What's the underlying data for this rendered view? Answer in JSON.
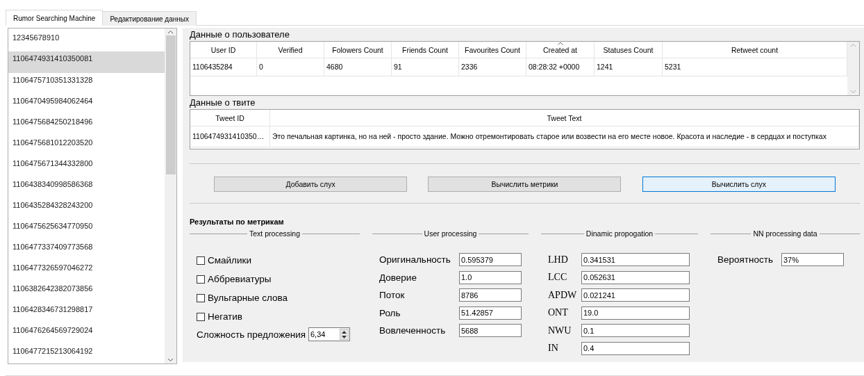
{
  "tabs": [
    {
      "label": "Rumor Searching Machine",
      "selected": true
    },
    {
      "label": "Редактирование данных",
      "selected": false
    }
  ],
  "tweet_list": {
    "items": [
      {
        "label": "12345678910",
        "selected": false
      },
      {
        "label": "1106474931410350081",
        "selected": true
      },
      {
        "label": "1106475710351331328",
        "selected": false
      },
      {
        "label": "1106470495984062464",
        "selected": false
      },
      {
        "label": "1106475684250218496",
        "selected": false
      },
      {
        "label": "1106475681012203520",
        "selected": false
      },
      {
        "label": "1106475671344332800",
        "selected": false
      },
      {
        "label": "1106438340998586368",
        "selected": false
      },
      {
        "label": "1106435284328243200",
        "selected": false
      },
      {
        "label": "1106475625634770950",
        "selected": false
      },
      {
        "label": "1106477337409773568",
        "selected": false
      },
      {
        "label": "1106477326597046272",
        "selected": false
      },
      {
        "label": "1106382642382073856",
        "selected": false
      },
      {
        "label": "1106428346731298817",
        "selected": false
      },
      {
        "label": "1106476264569729024",
        "selected": false
      },
      {
        "label": "1106477215213064192",
        "selected": false
      }
    ]
  },
  "user_section": {
    "title": "Данные о пользователе",
    "columns": [
      {
        "label": "User ID",
        "sorted": false
      },
      {
        "label": "Verified",
        "sorted": false
      },
      {
        "label": "Folowers Count",
        "sorted": false
      },
      {
        "label": "Friends Count",
        "sorted": false
      },
      {
        "label": "Favourites Count",
        "sorted": false
      },
      {
        "label": "Created at",
        "sorted": true
      },
      {
        "label": "Statuses Count",
        "sorted": false
      },
      {
        "label": "Retweet count",
        "sorted": false
      }
    ],
    "rows": [
      [
        "1106435284",
        "0",
        "4680",
        "91",
        "2336",
        "08:28:32 +0000",
        "1241",
        "5231"
      ]
    ]
  },
  "tweet_section": {
    "title": "Данные о твите",
    "columns": [
      {
        "label": "Tweet ID"
      },
      {
        "label": "Tweet Text"
      }
    ],
    "rows": [
      [
        "1106474931410350…",
        "Это печальная картинка, но на ней - просто здание. Можно отремонтировать старое или возвести на его месте новое. Красота и наследие - в сердцах и поступках"
      ]
    ]
  },
  "buttons": [
    {
      "label": "Добавить слух",
      "focused": false
    },
    {
      "label": "Вычислить метрики",
      "focused": false
    },
    {
      "label": "Вычислить слух",
      "focused": true
    }
  ],
  "results": {
    "title": "Результаты по метрикам",
    "groups": [
      {
        "title": "Text processing",
        "kind": "checks",
        "items": [
          {
            "label": "Смайлики",
            "checked": false
          },
          {
            "label": "Аббревиатуры",
            "checked": false
          },
          {
            "label": "Вульгарные слова",
            "checked": false
          },
          {
            "label": "Негатив",
            "checked": false
          }
        ],
        "spinner": {
          "label": "Сложность предложения",
          "value": "6,34"
        }
      },
      {
        "title": "User processing",
        "kind": "fields",
        "items": [
          {
            "label": "Оригинальность",
            "value": "0.595379"
          },
          {
            "label": "Доверие",
            "value": "1.0"
          },
          {
            "label": "Поток",
            "value": "8786"
          },
          {
            "label": "Роль",
            "value": "51.42857"
          },
          {
            "label": "Вовлеченность",
            "value": "5688"
          }
        ]
      },
      {
        "title": "Dinamic propogation",
        "kind": "serif_fields",
        "items": [
          {
            "label": "LHD",
            "value": "0.341531"
          },
          {
            "label": "LCC",
            "value": "0.052631"
          },
          {
            "label": "APDW",
            "value": "0.021241"
          },
          {
            "label": "ONT",
            "value": "19.0"
          },
          {
            "label": "NWU",
            "value": "0.1"
          },
          {
            "label": "IN",
            "value": "0.4"
          }
        ]
      },
      {
        "title": "NN processing data",
        "kind": "prob_fields",
        "items": [
          {
            "label": "Вероятность",
            "value": "37%"
          }
        ]
      }
    ]
  }
}
